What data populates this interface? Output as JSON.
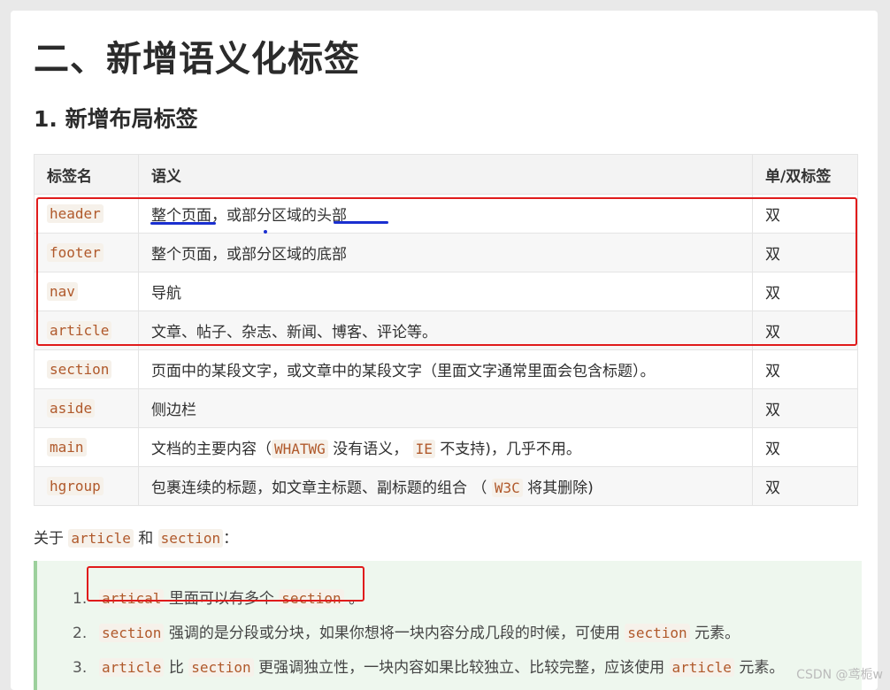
{
  "title": "二、新增语义化标签",
  "subtitle": "1. 新增布局标签",
  "table": {
    "headers": [
      "标签名",
      "语义",
      "单/双标签"
    ],
    "rows": [
      {
        "tag": "header",
        "meaning": "整个页面，或部分区域的头部",
        "type": "双"
      },
      {
        "tag": "footer",
        "meaning": "整个页面，或部分区域的底部",
        "type": "双"
      },
      {
        "tag": "nav",
        "meaning": "导航",
        "type": "双"
      },
      {
        "tag": "article",
        "meaning": "文章、帖子、杂志、新闻、博客、评论等。",
        "type": "双"
      },
      {
        "tag": "section",
        "meaning": "页面中的某段文字，或文章中的某段文字（里面文字通常里面会包含标题）。",
        "type": "双"
      },
      {
        "tag": "aside",
        "meaning": "侧边栏",
        "type": "双"
      },
      {
        "tag": "main",
        "meaning_parts": [
          "文档的主要内容（",
          "WHATWG",
          " 没有语义， ",
          "IE",
          " 不支持)，几乎不用。"
        ],
        "type": "双"
      },
      {
        "tag": "hgroup",
        "meaning_parts": [
          "包裹连续的标题，如文章主标题、副标题的组合 （ ",
          "W3C",
          " 将其删除)"
        ],
        "type": "双"
      }
    ]
  },
  "about": {
    "prefix": "关于 ",
    "code1": "article",
    "mid": " 和 ",
    "code2": "section",
    "suffix": "："
  },
  "list": [
    {
      "num": "1.",
      "code": "artical",
      "text": " 里面可以有多个 ",
      "code2": "section",
      "end": " 。"
    },
    {
      "num": "2.",
      "code": "section",
      "text": " 强调的是分段或分块，如果你想将一块内容分成几段的时候，可使用 ",
      "code2": "section",
      "end": " 元素。"
    },
    {
      "num": "3.",
      "code": "article",
      "text": " 比 ",
      "code2": "section",
      "end": " 更强调独立性，一块内容如果比较独立、比较完整，应该使用 ",
      "code3": "article",
      "end2": " 元素。"
    }
  ],
  "watermark": "CSDN @鸢栀w",
  "colors": {
    "highlight_box": "#e01b1b",
    "underline": "#1a2fd0",
    "code_text": "#b0592b",
    "quote_bg": "#eef7ee"
  }
}
